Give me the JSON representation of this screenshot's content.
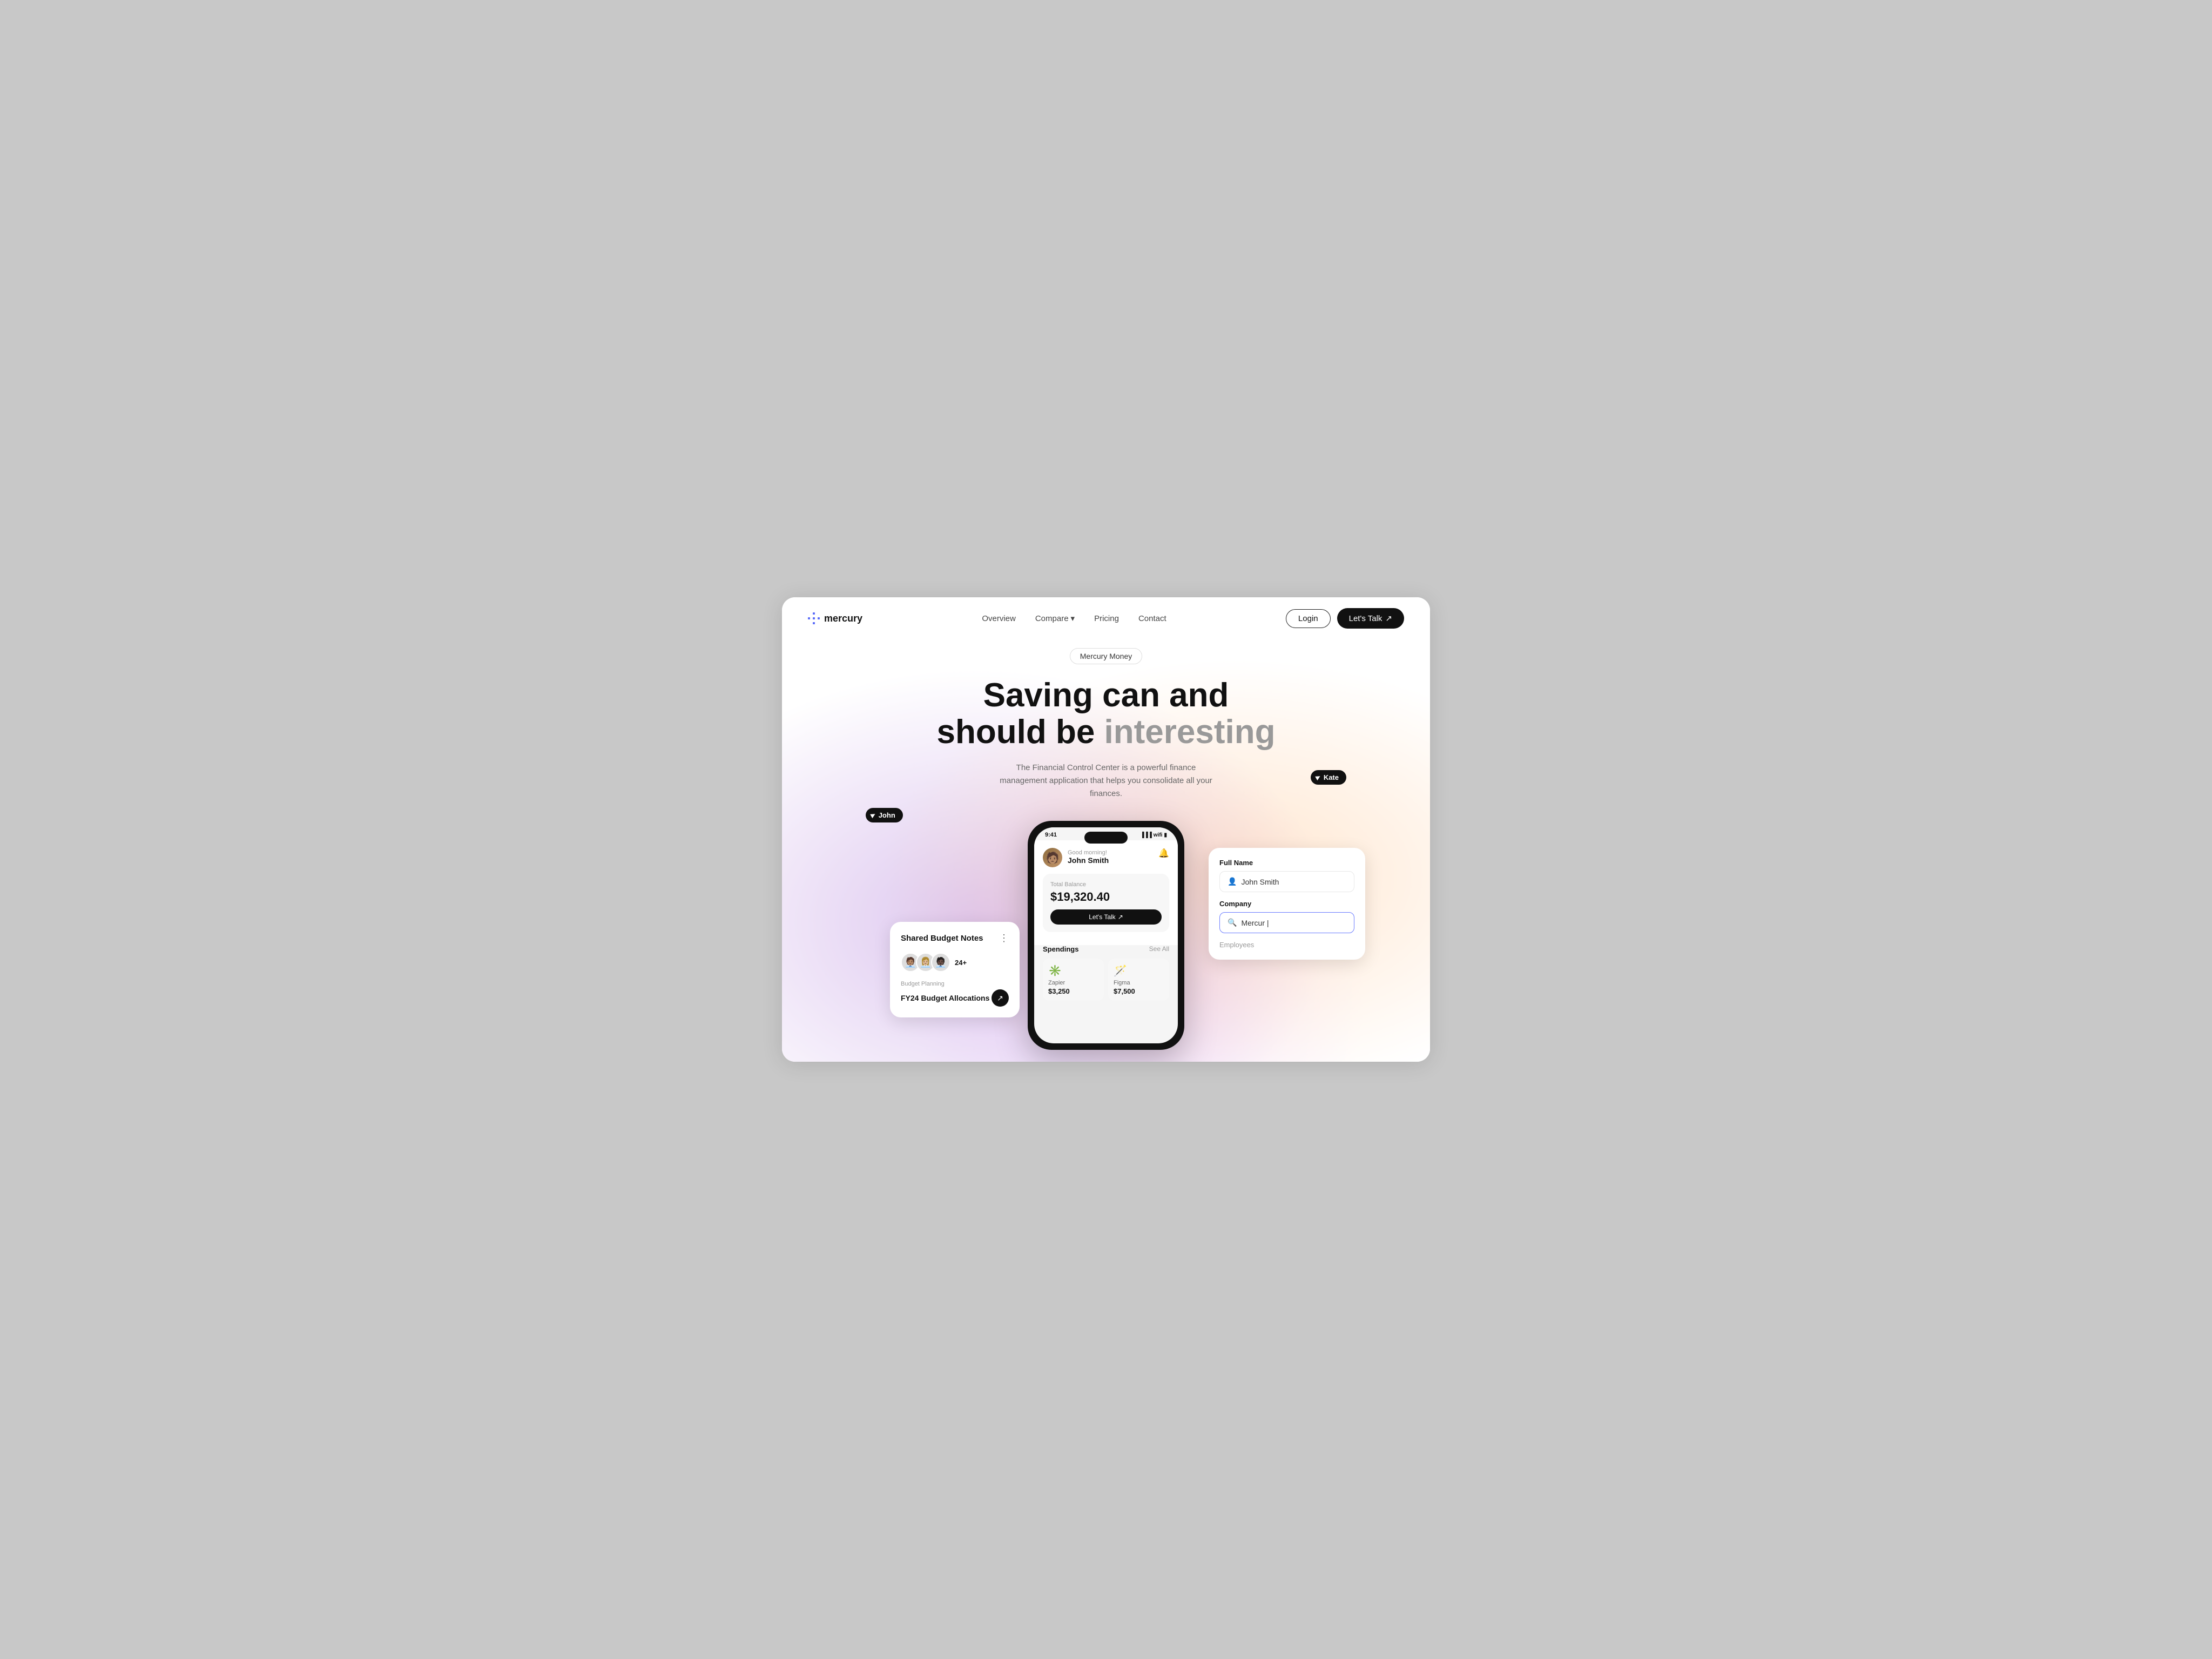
{
  "meta": {
    "bg_color": "#c8c8c8",
    "card_bg": "#ffffff"
  },
  "nav": {
    "logo_text": "mercury",
    "links": [
      {
        "label": "Overview",
        "has_dropdown": false
      },
      {
        "label": "Compare",
        "has_dropdown": true
      },
      {
        "label": "Pricing",
        "has_dropdown": false
      },
      {
        "label": "Contact",
        "has_dropdown": false
      }
    ],
    "login_label": "Login",
    "cta_label": "Let's Talk",
    "cta_arrow": "↗"
  },
  "hero": {
    "badge": "Mercury Money",
    "title_line1": "Saving can and",
    "title_line2_plain": "should be ",
    "title_line2_highlight": "interesting",
    "description": "The Financial Control Center is a powerful finance management application that helps you consolidate all your finances.",
    "cursor_john": "John",
    "cursor_kate": "Kate"
  },
  "phone": {
    "time": "9:41",
    "greeting": "Good morning!",
    "user_name": "John Smith",
    "balance_label": "Total Balance",
    "balance_amount": "$19,320.40",
    "cta_label": "Let's Talk",
    "cta_arrow": "↗",
    "spendings_title": "Spendings",
    "see_all": "See All",
    "spendings": [
      {
        "icon": "✳️",
        "name": "Zapier",
        "amount": "$3,250"
      },
      {
        "icon": "🪄",
        "name": "Figma",
        "amount": "$7,500"
      }
    ]
  },
  "budget_card": {
    "title": "Shared Budget Notes",
    "dots": "⋮",
    "avatar_count": "24+",
    "budget_label": "Budget Planning",
    "budget_name": "FY24 Budget Allocations",
    "arrow": "↗"
  },
  "form_card": {
    "full_name_label": "Full Name",
    "full_name_value": "John Smith",
    "company_label": "Company",
    "company_value": "Mercur |",
    "employees_label": "Employees"
  }
}
